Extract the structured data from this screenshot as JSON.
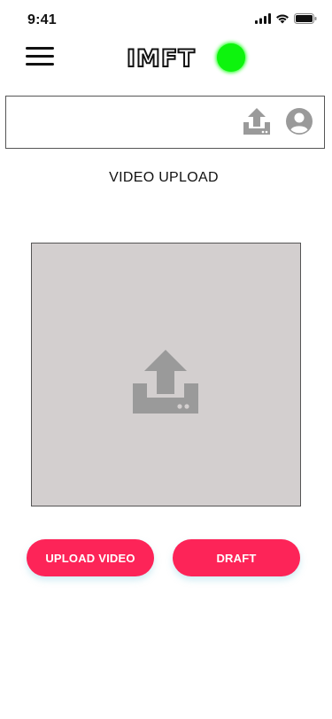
{
  "status_bar": {
    "time": "9:41",
    "icons": [
      "signal-icon",
      "wifi-icon",
      "battery-icon"
    ]
  },
  "header": {
    "menu_icon": "hamburger-menu-icon",
    "logo_text": "IMFT",
    "logo_dot_color": "#0df40d"
  },
  "toolbar": {
    "icons": [
      "upload-icon",
      "profile-icon"
    ],
    "icon_color": "#9a9a9a"
  },
  "main": {
    "title": "VIDEO UPLOAD",
    "dropzone_icon": "upload-icon",
    "dropzone_color": "#d3cfcf"
  },
  "actions": {
    "upload_label": "UPLOAD VIDEO",
    "draft_label": "DRAFT",
    "accent_color": "#fd2458"
  }
}
